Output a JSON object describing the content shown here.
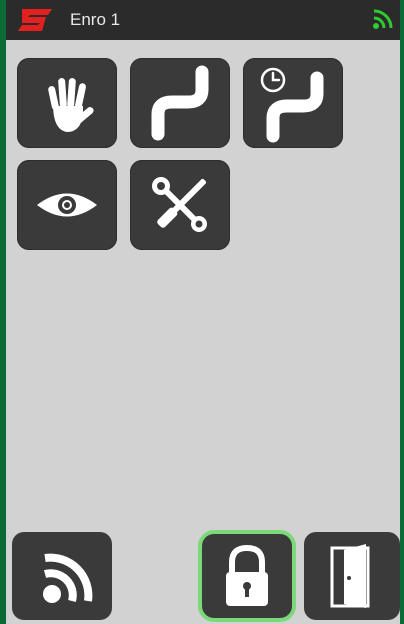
{
  "header": {
    "title": "Enro 1",
    "logo_icon": "brand-logo-icon",
    "connection_icon": "wifi-signal-icon",
    "connection_color": "#2ecc2e"
  },
  "tiles": [
    {
      "icon": "hand-icon"
    },
    {
      "icon": "curve-path-icon"
    },
    {
      "icon": "scheduled-curve-icon"
    },
    {
      "icon": "eye-icon"
    },
    {
      "icon": "tools-icon"
    }
  ],
  "bottom_bar": {
    "buttons": [
      {
        "icon": "wifi-signal-icon"
      },
      {
        "icon": "lock-icon",
        "active": true,
        "highlight_color": "#7cd97a"
      },
      {
        "icon": "exit-door-icon"
      }
    ]
  },
  "colors": {
    "background": "#d2d2d2",
    "tile": "#3a3a3a",
    "header": "#2b2b2b",
    "accent_red": "#e32020",
    "frame": "#0a6b36"
  }
}
